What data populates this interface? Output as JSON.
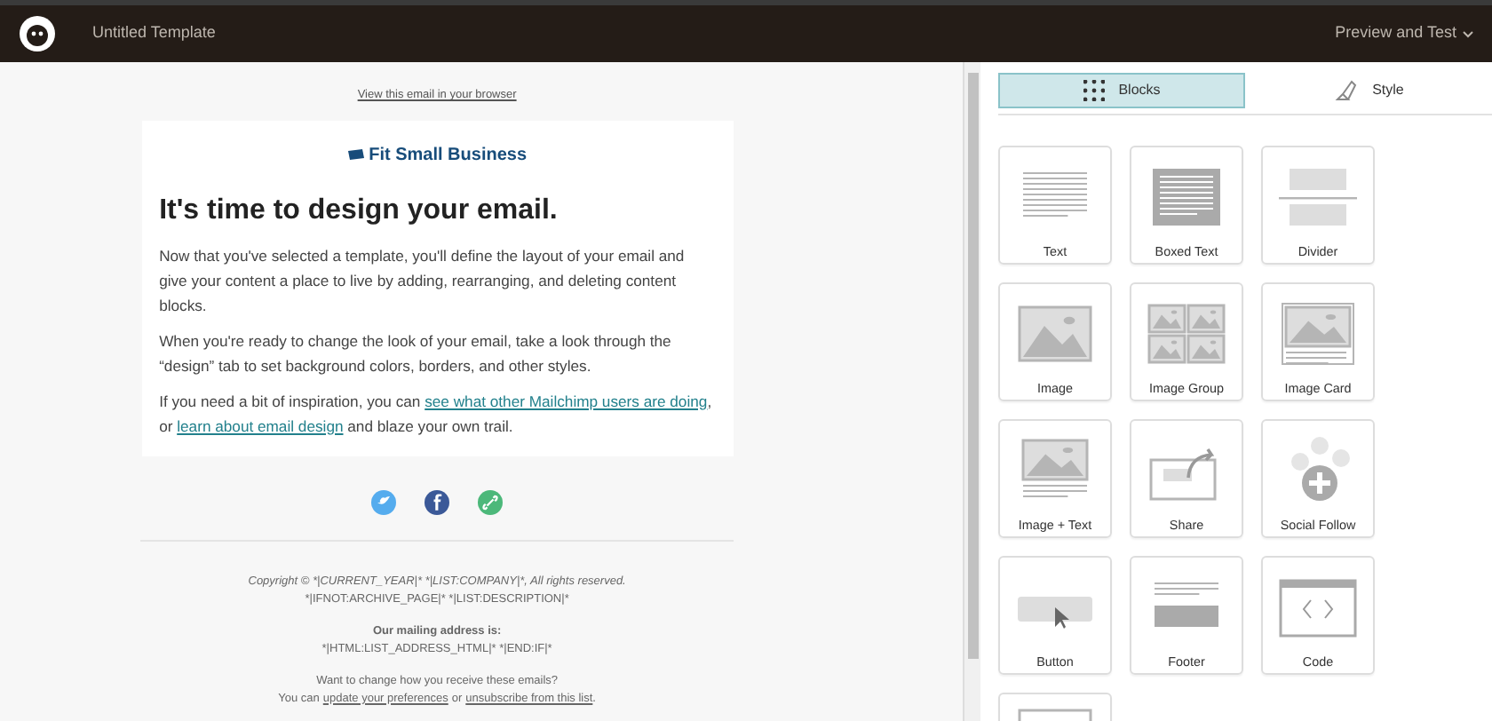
{
  "header": {
    "title": "Untitled Template",
    "action": "Preview and Test"
  },
  "email": {
    "browser_link": "View this email in your browser",
    "logo": "Fit Small Business",
    "heading": "It's time to design your email.",
    "paragraphs": [
      "Now that you've selected a template, you'll define the layout of your email and give your content a place to live by adding, rearranging, and deleting content blocks.",
      "When you're ready to change the look of your email, take a look through the “design” tab to set background colors, borders, and other styles."
    ],
    "inspiration": {
      "before": "If you need a bit of inspiration, you can",
      "link1": "see what other Mailchimp users are doing",
      "middle": ", or",
      "link2": "learn about email design",
      "after": "and blaze your own trail."
    },
    "social": [
      {
        "kind": "twitter",
        "color": "#55acee"
      },
      {
        "kind": "facebook",
        "color": "#3b5998"
      },
      {
        "kind": "link",
        "color": "#4cb87a"
      }
    ],
    "footer": {
      "copyright": "Copyright © *|CURRENT_YEAR|* *|LIST:COMPANY|*, All rights reserved.",
      "description": "*|IFNOT:ARCHIVE_PAGE|* *|LIST:DESCRIPTION|*",
      "address_label": "Our mailing address is:",
      "address": "*|HTML:LIST_ADDRESS_HTML|* *|END:IF|*",
      "change": "Want to change how you receive these emails?",
      "you_can": "You can",
      "prefs": "update your preferences",
      "or": "or",
      "unsub": "unsubscribe from this list",
      "end": "."
    }
  },
  "tabs": [
    {
      "label": "Blocks",
      "kind": "blocks",
      "selected": true
    },
    {
      "label": "Style",
      "kind": "style",
      "selected": false
    }
  ],
  "blocks": [
    {
      "kind": "text",
      "label": "Text"
    },
    {
      "kind": "boxed",
      "label": "Boxed Text"
    },
    {
      "kind": "divider",
      "label": "Divider"
    },
    {
      "kind": "image",
      "label": "Image"
    },
    {
      "kind": "group",
      "label": "Image Group"
    },
    {
      "kind": "card",
      "label": "Image Card"
    },
    {
      "kind": "imagetext",
      "label": "Image + Text"
    },
    {
      "kind": "share",
      "label": "Share"
    },
    {
      "kind": "social",
      "label": "Social Follow"
    },
    {
      "kind": "button",
      "label": "Button"
    },
    {
      "kind": "footer",
      "label": "Footer"
    },
    {
      "kind": "code",
      "label": "Code"
    },
    {
      "kind": "partial"
    }
  ]
}
